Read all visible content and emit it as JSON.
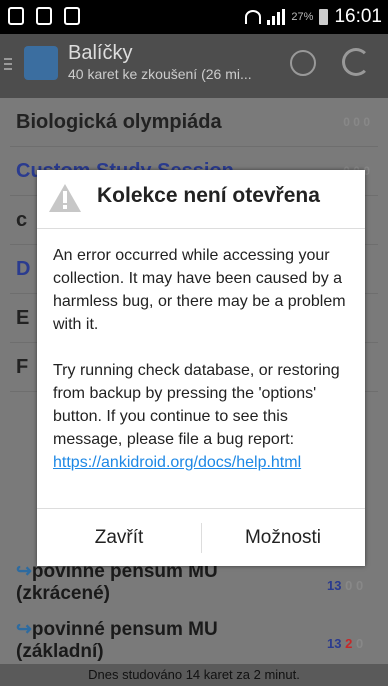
{
  "status_bar": {
    "time": "16:01",
    "battery": "27%"
  },
  "app_bar": {
    "title": "Balíčky",
    "subtitle": "40 karet ke zkoušení (26 mi..."
  },
  "decks": [
    {
      "name": "Biologická olympiáda",
      "counts": "0 0 0"
    },
    {
      "name": "Custom Study Session",
      "counts": "0 0 0"
    },
    {
      "name": "c",
      "counts": ""
    },
    {
      "name": "D",
      "counts": ""
    },
    {
      "name": "E",
      "counts": ""
    },
    {
      "name": "F",
      "counts": ""
    }
  ],
  "dialog": {
    "title": "Kolekce není otevřena",
    "message1": "An error occurred while accessing your collection. It may have been caused by a harmless bug, or there may be a problem with it.",
    "message2": "Try running check database, or restoring from backup by pressing the 'options' button. If you continue to see this message, please file a bug report:",
    "link": "https://ankidroid.org/docs/help.html",
    "close_label": "Zavřít",
    "options_label": "Možnosti"
  },
  "lower_decks": [
    {
      "line1": "povinné pensum MU",
      "line2": "(zkrácené)",
      "counts": [
        "13",
        "0",
        "0"
      ]
    },
    {
      "line1": "povinné pensum MU",
      "line2": "(základní)",
      "counts": [
        "13",
        "2",
        "0"
      ]
    }
  ],
  "footer": "Dnes studováno 14 karet za 2 minut."
}
